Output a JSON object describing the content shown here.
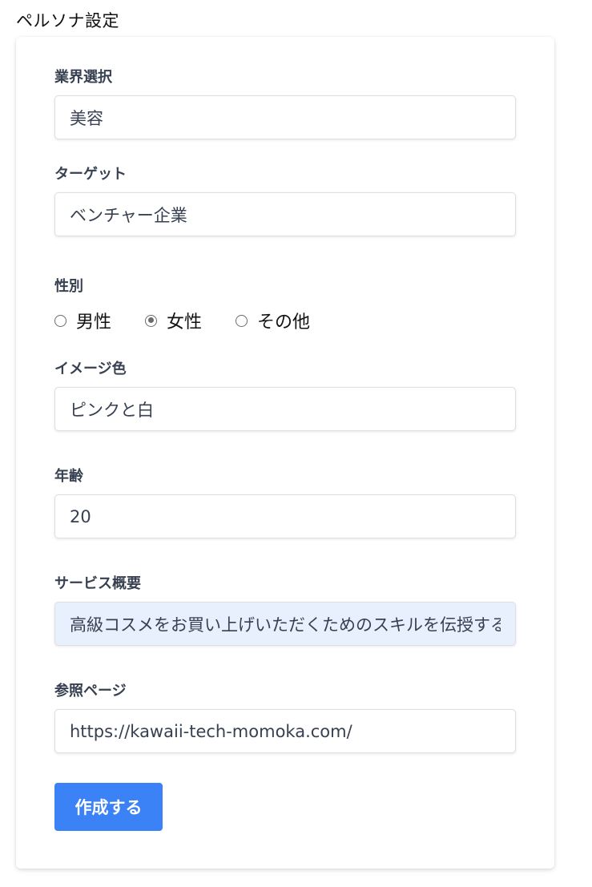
{
  "page": {
    "title": "ペルソナ設定"
  },
  "form": {
    "industry": {
      "label": "業界選択",
      "value": "美容"
    },
    "target": {
      "label": "ターゲット",
      "value": "ベンチャー企業"
    },
    "gender": {
      "label": "性別",
      "options": [
        "男性",
        "女性",
        "その他"
      ],
      "selected": "女性"
    },
    "image_color": {
      "label": "イメージ色",
      "value": "ピンクと白"
    },
    "age": {
      "label": "年齢",
      "value": "20"
    },
    "service_summary": {
      "label": "サービス概要",
      "value": "高級コスメをお買い上げいただくためのスキルを伝授するセミナー"
    },
    "reference_page": {
      "label": "参照ページ",
      "value": "https://kawaii-tech-momoka.com/"
    },
    "submit_label": "作成する"
  },
  "colors": {
    "accent": "#3b82f6",
    "autofill_bg": "#e8f0fe"
  }
}
